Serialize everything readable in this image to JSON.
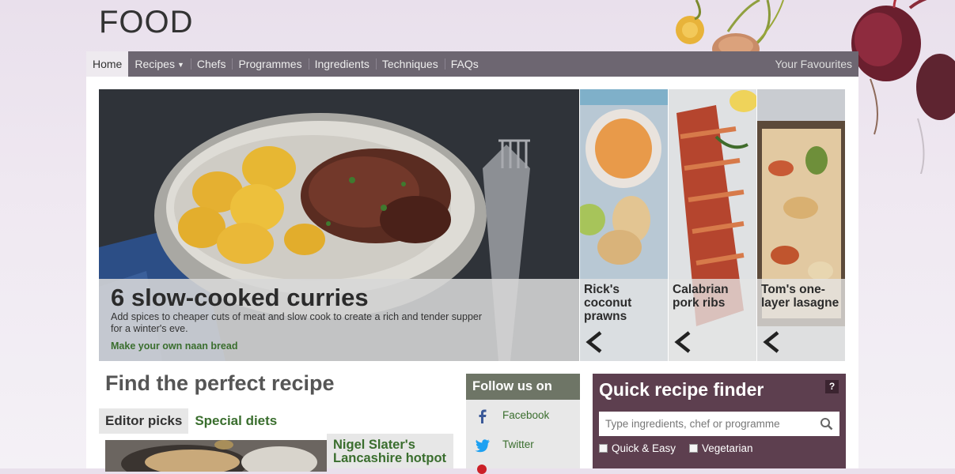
{
  "header": {
    "logo": "FOOD"
  },
  "nav": {
    "items": [
      {
        "label": "Home"
      },
      {
        "label": "Recipes"
      },
      {
        "label": "Chefs"
      },
      {
        "label": "Programmes"
      },
      {
        "label": "Ingredients"
      },
      {
        "label": "Techniques"
      },
      {
        "label": "FAQs"
      }
    ],
    "favourites": "Your Favourites",
    "recipes_caret": "chevron-down-icon"
  },
  "hero": {
    "title": "6 slow-cooked curries",
    "description": "Add spices to cheaper cuts of meat and slow cook to create a rich and tender supper for a winter's eve.",
    "link": "Make your own naan bread"
  },
  "cards": [
    {
      "title": "Rick's coconut prawns"
    },
    {
      "title": "Calabrian pork ribs"
    },
    {
      "title": "Tom's one-layer lasagne"
    }
  ],
  "find": {
    "title": "Find the perfect recipe",
    "tabs": [
      {
        "label": "Editor picks"
      },
      {
        "label": "Special diets"
      }
    ],
    "pick_title": "Nigel Slater's Lancashire hotpot"
  },
  "follow": {
    "title": "Follow us on",
    "links": [
      {
        "label": "Facebook",
        "icon": "facebook-icon"
      },
      {
        "label": "Twitter",
        "icon": "twitter-icon"
      }
    ]
  },
  "finder": {
    "title": "Quick recipe finder",
    "help": "?",
    "placeholder": "Type ingredients, chef or programme",
    "options": [
      {
        "label": "Quick & Easy"
      },
      {
        "label": "Vegetarian"
      }
    ]
  },
  "colors": {
    "nav_bg": "#6d6671",
    "finder_bg": "#5d3f4f",
    "follow_head": "#6e7566",
    "link_green": "#3a6e2e"
  }
}
